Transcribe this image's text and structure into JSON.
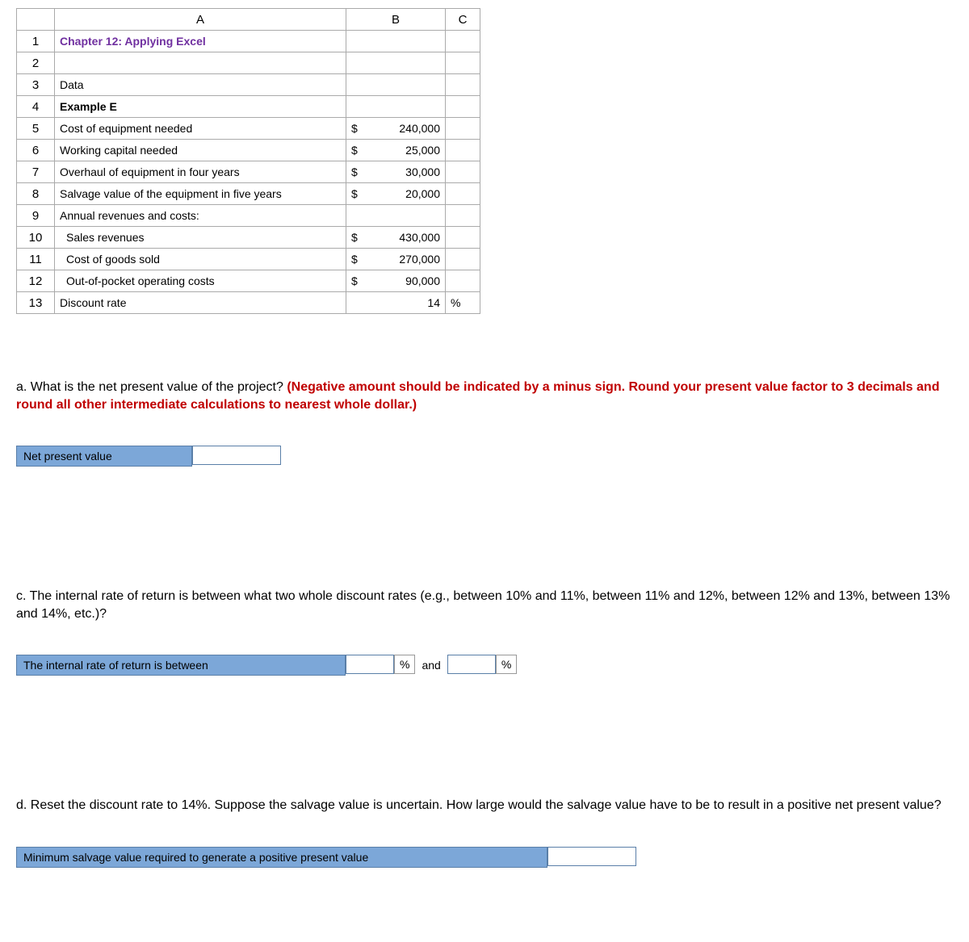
{
  "columns": {
    "a": "A",
    "b": "B",
    "c": "C"
  },
  "rows": {
    "r1": {
      "n": "1",
      "a": "Chapter 12: Applying Excel"
    },
    "r2": {
      "n": "2",
      "a": ""
    },
    "r3": {
      "n": "3",
      "a": "Data"
    },
    "r4": {
      "n": "4",
      "a": "Example E"
    },
    "r5": {
      "n": "5",
      "a": "Cost of equipment needed",
      "sym": "$",
      "b": "240,000"
    },
    "r6": {
      "n": "6",
      "a": "Working capital needed",
      "sym": "$",
      "b": "25,000"
    },
    "r7": {
      "n": "7",
      "a": "Overhaul of equipment in four years",
      "sym": "$",
      "b": "30,000"
    },
    "r8": {
      "n": "8",
      "a": "Salvage value of the equipment in five years",
      "sym": "$",
      "b": "20,000"
    },
    "r9": {
      "n": "9",
      "a": "Annual revenues and costs:"
    },
    "r10": {
      "n": "10",
      "a": "Sales revenues",
      "sym": "$",
      "b": "430,000"
    },
    "r11": {
      "n": "11",
      "a": "Cost of goods sold",
      "sym": "$",
      "b": "270,000"
    },
    "r12": {
      "n": "12",
      "a": "Out-of-pocket operating costs",
      "sym": "$",
      "b": "90,000"
    },
    "r13": {
      "n": "13",
      "a": "Discount rate",
      "b": "14",
      "c": "%"
    }
  },
  "qa": {
    "prefix": "a. What is the net present value of the project? ",
    "red": "(Negative amount should be indicated by a minus sign. Round your present value factor to 3 decimals and round all other intermediate calculations to nearest whole dollar.)",
    "label": "Net present value"
  },
  "qc": {
    "text": "c. The internal rate of return is between what two whole discount rates (e.g., between 10% and 11%, between 11% and 12%, between 12% and 13%, between 13% and 14%, etc.)?",
    "label": "The internal rate of return is between",
    "pct": "%",
    "and": "and"
  },
  "qd": {
    "text": "d. Reset the discount rate to 14%. Suppose the salvage value is uncertain. How large would the salvage value have to be to result in a positive net present value?",
    "label": "Minimum salvage value required to generate a positive present value"
  }
}
